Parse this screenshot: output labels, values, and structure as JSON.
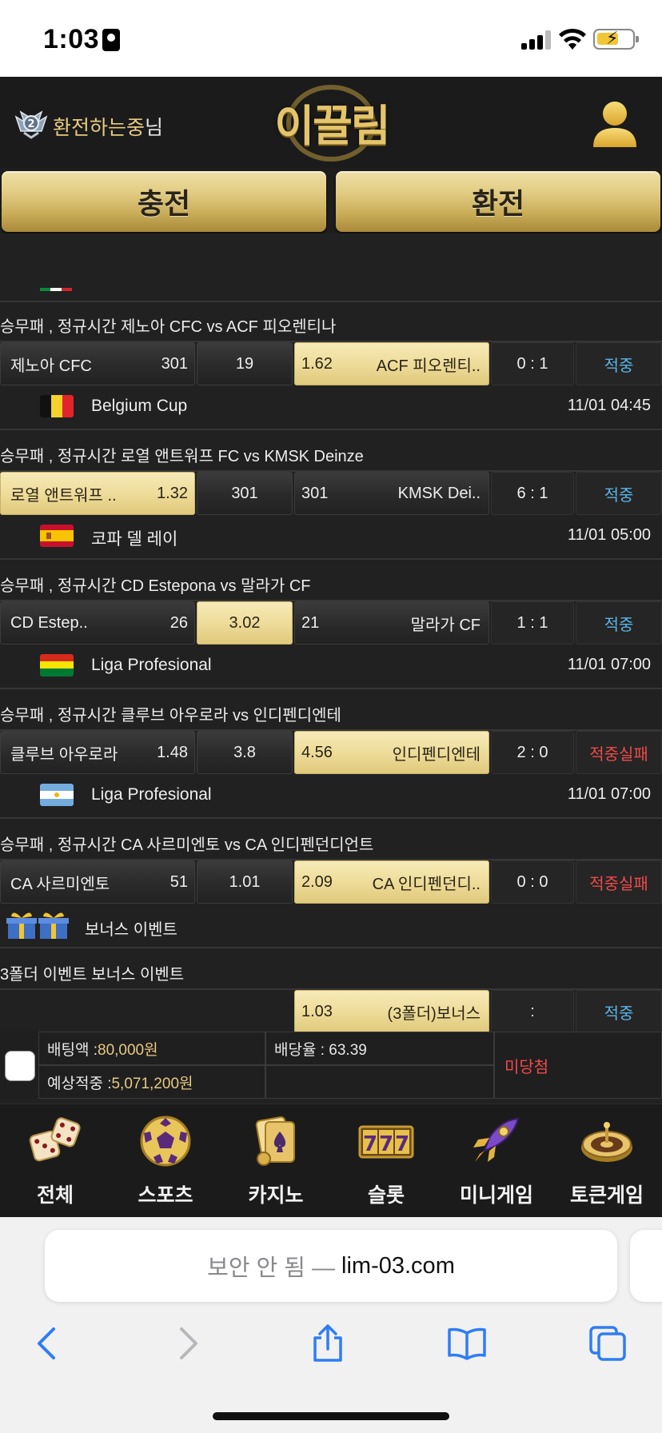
{
  "status_bar": {
    "time": "1:03"
  },
  "header": {
    "username": "환전하는중",
    "username_suffix": "님",
    "logo_text": "이끌림",
    "buttons": {
      "charge": "충전",
      "exchange": "환전"
    }
  },
  "bets": [
    {
      "market": "승무패 , 정규시간 제노아 CFC  vs  ACF 피오렌티나",
      "home_team": "제노아 CFC",
      "home_odds": "301",
      "draw": "19",
      "away_odds": "1.62",
      "away_team": "ACF 피오렌티..",
      "score": "0 : 1",
      "status": "적중",
      "selected": "away"
    },
    {
      "league": "Belgium Cup",
      "time": "11/01 04:45",
      "market": "승무패 , 정규시간 로열 앤트워프 FC  vs  KMSK Deinze",
      "home_team": "로열 앤트워프 ..",
      "home_odds": "1.32",
      "draw": "301",
      "away_odds": "301",
      "away_team": "KMSK Dei..",
      "score": "6 : 1",
      "status": "적중",
      "selected": "home"
    },
    {
      "league": "코파 델 레이",
      "time": "11/01 05:00",
      "market": "승무패 , 정규시간 CD Estepona  vs  말라가 CF",
      "home_team": "CD Estep..",
      "home_odds": "26",
      "draw": "3.02",
      "away_odds": "21",
      "away_team": "말라가 CF",
      "score": "1 : 1",
      "status": "적중",
      "selected": "draw"
    },
    {
      "league": "Liga Profesional",
      "time": "11/01 07:00",
      "market": "승무패 , 정규시간 클루브 아우로라  vs  인디펜디엔테",
      "home_team": "클루브 아우로라",
      "home_odds": "1.48",
      "draw": "3.8",
      "away_odds": "4.56",
      "away_team": "인디펜디엔테",
      "score": "2 : 0",
      "status": "적중실패",
      "selected": "away"
    },
    {
      "league": "Liga Profesional",
      "time": "11/01 07:00",
      "market": "승무패 , 정규시간 CA 사르미엔토  vs  CA 인디펜던디언트",
      "home_team": "CA 사르미엔토",
      "home_odds": "51",
      "draw": "1.01",
      "away_odds": "2.09",
      "away_team": "CA 인디펜던디..",
      "score": "0 : 0",
      "status": "적중실패",
      "selected": "away"
    }
  ],
  "bonus": {
    "label": "보너스 이벤트",
    "market": "3폴더 이벤트 보너스 이벤트",
    "odds": "1.03",
    "name": "(3폴더)보너스",
    "score": ":",
    "status": "적중"
  },
  "summary": {
    "bet_amount_label": "배팅액 : ",
    "bet_amount": "80,000원",
    "rate_label": "배당율 : 63.39",
    "expected_label": "예상적중 : ",
    "expected_amount": "5,071,200원",
    "status": "미당첨"
  },
  "bottom_nav": [
    {
      "label": "전체",
      "icon": "dice-icon"
    },
    {
      "label": "스포츠",
      "icon": "soccer-ball-icon"
    },
    {
      "label": "카지노",
      "icon": "cards-icon"
    },
    {
      "label": "슬롯",
      "icon": "slot-777-icon"
    },
    {
      "label": "미니게임",
      "icon": "rocket-icon"
    },
    {
      "label": "토큰게임",
      "icon": "roulette-icon"
    }
  ],
  "safari": {
    "insecure_label": "보안 안 됨 —",
    "domain": "lim-03.com"
  },
  "colors": {
    "gold": "#e7c982",
    "hit": "#5ab3e6",
    "miss": "#ef4a4a",
    "background": "#212121"
  }
}
